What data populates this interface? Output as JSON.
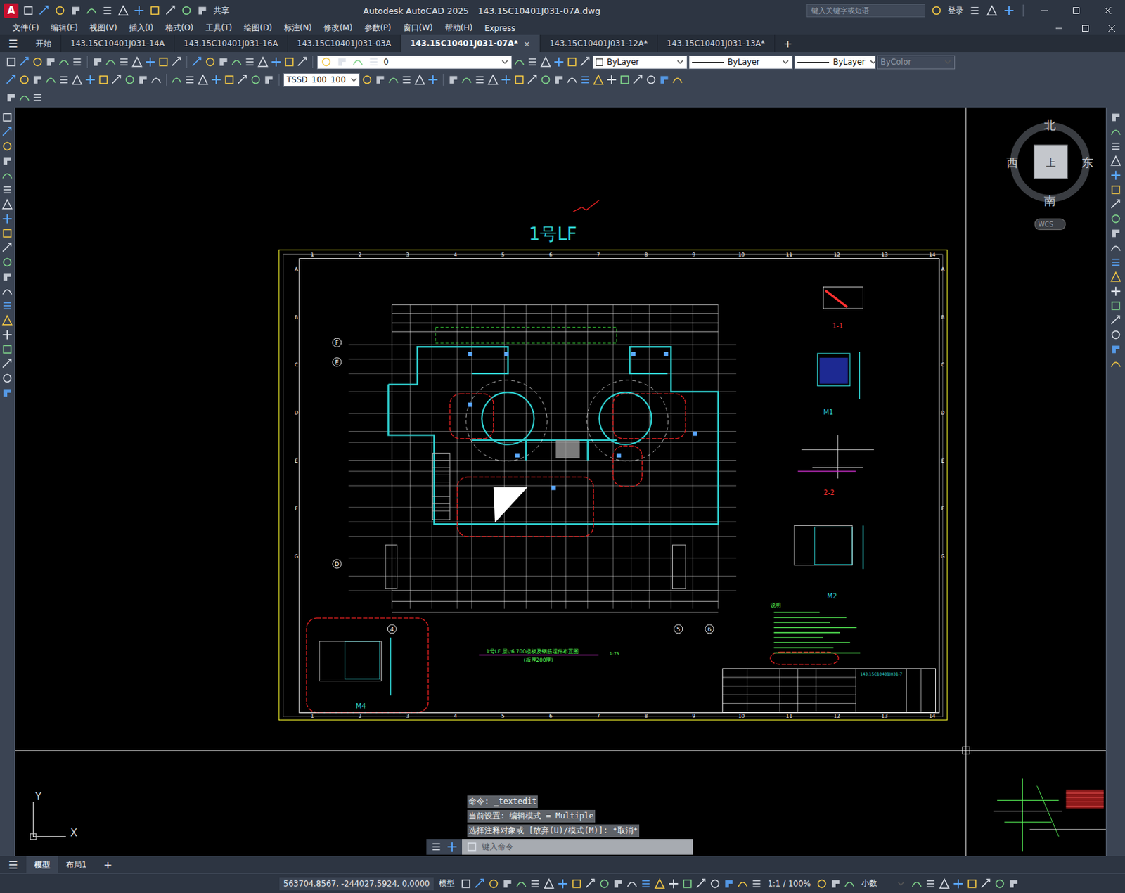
{
  "window": {
    "app_badge": "A",
    "title": "Autodesk AutoCAD 2025",
    "file": "143.15C10401J031-07A.dwg",
    "share": "共享",
    "search_placeholder": "键入关键字或短语",
    "login": "登录"
  },
  "menu": [
    "文件(F)",
    "编辑(E)",
    "视图(V)",
    "插入(I)",
    "格式(O)",
    "工具(T)",
    "绘图(D)",
    "标注(N)",
    "修改(M)",
    "参数(P)",
    "窗口(W)",
    "帮助(H)",
    "Express"
  ],
  "doc_tabs": {
    "menu_glyph": "☰",
    "new_tab": "+",
    "close_glyph": "×",
    "items": [
      {
        "label": "开始",
        "selected": false
      },
      {
        "label": "143.15C10401J031-14A",
        "selected": false
      },
      {
        "label": "143.15C10401J031-16A",
        "selected": false
      },
      {
        "label": "143.15C10401J031-03A",
        "selected": false
      },
      {
        "label": "143.15C10401J031-07A*",
        "selected": true
      },
      {
        "label": "143.15C10401J031-12A*",
        "selected": false
      },
      {
        "label": "143.15C10401J031-13A*",
        "selected": false
      }
    ]
  },
  "properties": {
    "layer": "0",
    "color": "ByLayer",
    "linetype": "ByLayer",
    "lineweight": "ByLayer",
    "plot_style": {
      "label": "ByColor",
      "disabled": true
    },
    "text_style": "TSSD_100_100"
  },
  "viewcube": {
    "north": "北",
    "south": "南",
    "east": "东",
    "west": "西",
    "top": "上",
    "ucs": "WCS"
  },
  "ucs_icon": {
    "x": "X",
    "y": "Y"
  },
  "drawing": {
    "title": "1号LF",
    "grid_columns": [
      "1",
      "2",
      "3",
      "4",
      "5",
      "6",
      "7",
      "8",
      "9",
      "10",
      "11",
      "12",
      "13",
      "14"
    ],
    "grid_rows": [
      "A",
      "B",
      "C",
      "D",
      "E",
      "F",
      "G"
    ],
    "axis_bubbles": [
      "F",
      "E",
      "D",
      "4",
      "5",
      "6"
    ],
    "details": [
      {
        "label": "1-1",
        "color": "#ff3030"
      },
      {
        "label": "M1",
        "color": "#2fd0d0"
      },
      {
        "label": "2-2",
        "color": "#ff3030"
      },
      {
        "label": "M2",
        "color": "#2fd0d0"
      },
      {
        "label": "M4",
        "color": "#2fd0d0"
      }
    ],
    "plan_title": "1号LF 层▽6.700楼板及钢筋埋件布置图",
    "plan_subtitle": "(板厚200厚)",
    "plan_scale": "1:75",
    "notes_title": "说明",
    "drawing_no": "143.15C10401J031-7"
  },
  "command": {
    "history": [
      "命令: _textedit",
      "当前设置: 编辑模式 = Multiple",
      "选择注释对象或 [放弃(U)/模式(M)]: *取消*"
    ],
    "placeholder": "键入命令"
  },
  "layout_tabs": {
    "menu_glyph": "☰",
    "new_tab": "+",
    "items": [
      {
        "label": "模型",
        "selected": true
      },
      {
        "label": "布局1",
        "selected": false
      }
    ]
  },
  "status": {
    "coords": "563704.8567, -244027.5924, 0.0000",
    "space": "模型",
    "scale": "1:1 / 100%",
    "units": "小数"
  }
}
